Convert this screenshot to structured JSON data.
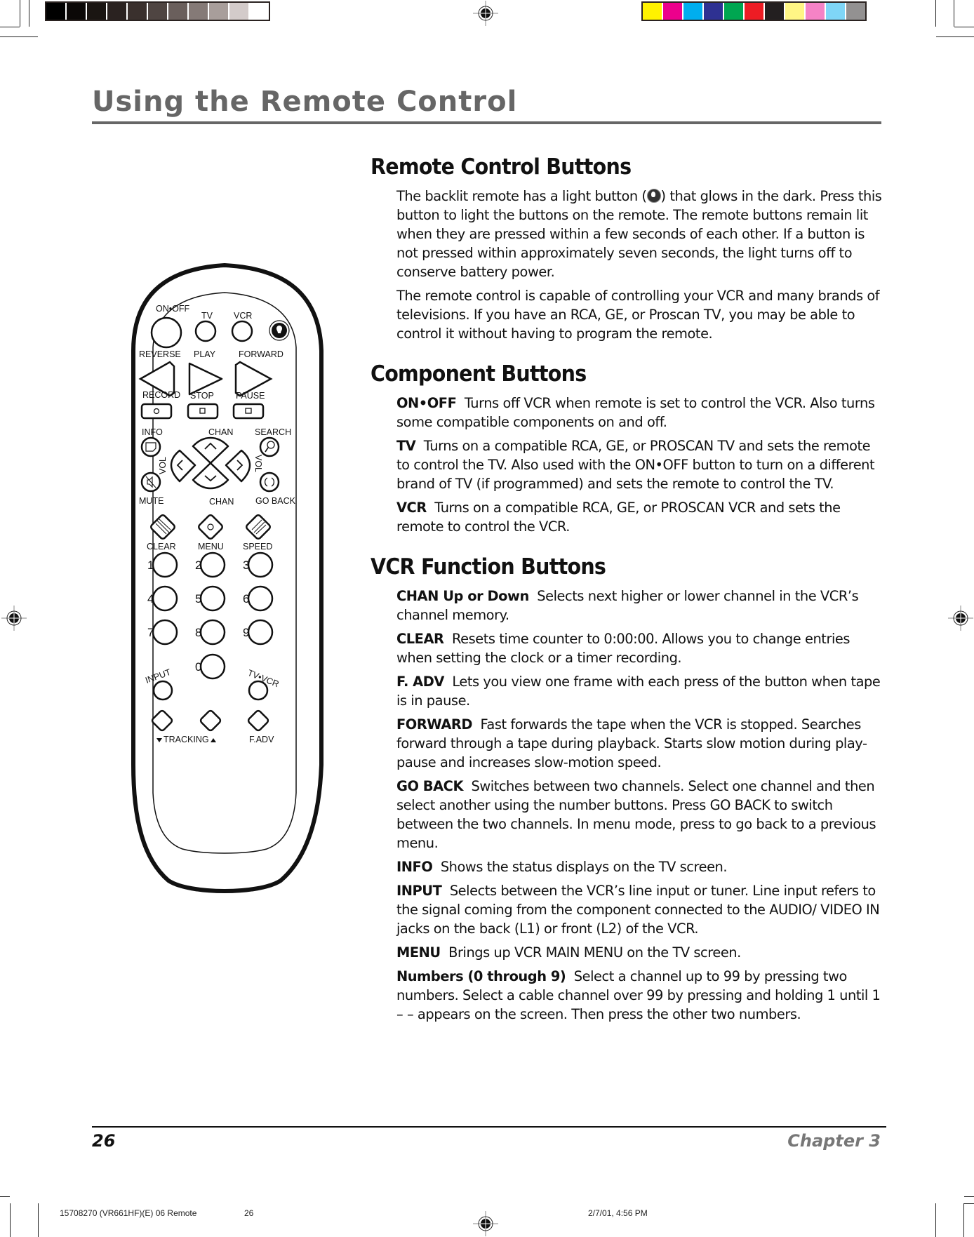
{
  "header": {
    "title": "Using the Remote Control"
  },
  "print_marks": {
    "grayscale_swatches": [
      "#000000",
      "#0b0807",
      "#1a1512",
      "#2a2220",
      "#3a302d",
      "#4f4542",
      "#6a5f5c",
      "#857a77",
      "#a89e9b",
      "#d3cbca",
      "#ffffff"
    ],
    "color_swatches": [
      "#fff200",
      "#ec008c",
      "#00aeef",
      "#2e3192",
      "#00a651",
      "#ed1c24",
      "#231f20",
      "#fff685",
      "#f583c6",
      "#7fd6f7",
      "#939191"
    ],
    "slug_file": "15708270 (VR661HF)(E) 06 Remote",
    "slug_page": "26",
    "slug_date": "2/7/01, 4:56 PM"
  },
  "remote": {
    "top_labels": {
      "on_off": "ON•OFF",
      "tv": "TV",
      "vcr": "VCR"
    },
    "transport_labels": {
      "reverse": "REVERSE",
      "play": "PLAY",
      "forward": "FORWARD",
      "record": "RECORD",
      "stop": "STOP",
      "pause": "PAUSE"
    },
    "nav_labels": {
      "info": "INFO",
      "chan_up": "CHAN",
      "search": "SEARCH",
      "vol_left": "VOL",
      "vol_right": "VOL",
      "mute": "MUTE",
      "chan_down": "CHAN",
      "go_back": "GO BACK"
    },
    "function_labels": {
      "clear": "CLEAR",
      "menu": "MENU",
      "speed": "SPEED"
    },
    "numbers": [
      "1",
      "2",
      "3",
      "4",
      "5",
      "6",
      "7",
      "8",
      "9",
      "0"
    ],
    "bottom_labels": {
      "input": "INPUT",
      "tv_vcr": "TV•VCR",
      "tracking": "TRACKING",
      "f_adv": "F.ADV"
    }
  },
  "sections": [
    {
      "heading": "Remote Control Buttons",
      "paragraphs": [
        {
          "term": "",
          "text_before": "The backlit remote has a light button (",
          "text_after": ") that glows in the dark. Press this button to light the buttons on the remote. The remote buttons remain lit when they are pressed within a few seconds of each other. If a button is not pressed within approximately seven seconds, the light turns off to conserve battery power."
        },
        {
          "term": "",
          "text": "The remote control is capable of controlling your VCR and many brands of televisions. If you have an RCA, GE, or Proscan TV, you may be able to control it without having to program the remote."
        }
      ]
    },
    {
      "heading": "Component Buttons",
      "paragraphs": [
        {
          "term": "ON•OFF",
          "text": "Turns off VCR when remote is set to control the VCR. Also turns some compatible components on and off."
        },
        {
          "term": "TV",
          "text": "Turns on a compatible RCA, GE, or PROSCAN TV and sets the remote to control the TV. Also used with the ON•OFF button to turn on a different brand of TV (if programmed) and sets the remote to control the TV."
        },
        {
          "term": "VCR",
          "text": "Turns on a compatible RCA, GE, or PROSCAN VCR and sets the remote to control the VCR."
        }
      ]
    },
    {
      "heading": "VCR Function Buttons",
      "paragraphs": [
        {
          "term": "CHAN Up or Down",
          "text": "Selects next higher or lower channel in the VCR’s channel memory."
        },
        {
          "term": "CLEAR",
          "text": "Resets time counter to 0:00:00. Allows you to change entries when setting the clock or a timer recording."
        },
        {
          "term": "F. ADV",
          "text": "Lets you view one frame with each press of the button when tape is in pause."
        },
        {
          "term": "FORWARD",
          "text": "Fast forwards the tape when the VCR is stopped. Searches forward through a tape during playback. Starts slow motion during play-pause and increases slow-motion speed."
        },
        {
          "term": "GO BACK",
          "text": "Switches between two channels. Select one channel and then select another using the number buttons. Press GO BACK to switch between the two channels. In menu mode, press to go back to a previous menu."
        },
        {
          "term": "INFO",
          "text": "Shows the status displays on the TV screen."
        },
        {
          "term": "INPUT",
          "text": "Selects between the VCR’s line input or tuner. Line input refers to the signal coming from the component connected to the AUDIO/ VIDEO IN jacks on the back (L1) or front (L2) of the VCR."
        },
        {
          "term": "MENU",
          "text": "Brings up VCR MAIN MENU on the TV screen."
        },
        {
          "term": "Numbers (0 through 9)",
          "text": "Select a channel up to 99 by pressing two numbers. Select a cable channel over 99 by pressing and holding 1 until 1 – – appears on the screen. Then press the other two numbers."
        }
      ]
    }
  ],
  "footer": {
    "page_number": "26",
    "chapter": "Chapter 3"
  }
}
